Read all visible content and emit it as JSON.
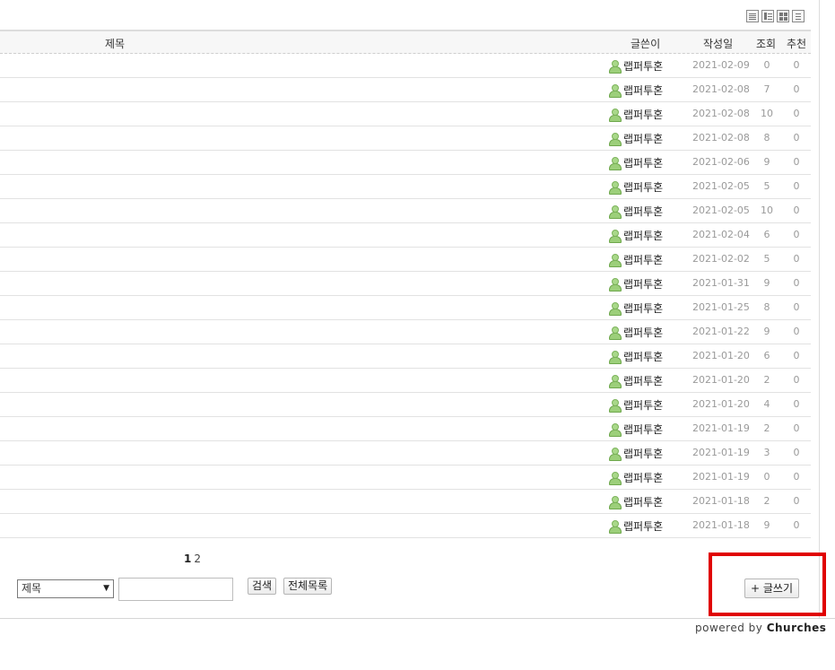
{
  "view_modes": [
    {
      "name": "list-view"
    },
    {
      "name": "webzine-view"
    },
    {
      "name": "gallery-view"
    },
    {
      "name": "text-view"
    }
  ],
  "table": {
    "headers": {
      "title": "제목",
      "author": "글쓴이",
      "date": "작성일",
      "views": "조회",
      "recommend": "추천"
    },
    "rows": [
      {
        "author": "랩퍼투혼",
        "date": "2021-02-09",
        "views": "0",
        "recommend": "0"
      },
      {
        "author": "랩퍼투혼",
        "date": "2021-02-08",
        "views": "7",
        "recommend": "0"
      },
      {
        "author": "랩퍼투혼",
        "date": "2021-02-08",
        "views": "10",
        "recommend": "0"
      },
      {
        "author": "랩퍼투혼",
        "date": "2021-02-08",
        "views": "8",
        "recommend": "0"
      },
      {
        "author": "랩퍼투혼",
        "date": "2021-02-06",
        "views": "9",
        "recommend": "0"
      },
      {
        "author": "랩퍼투혼",
        "date": "2021-02-05",
        "views": "5",
        "recommend": "0"
      },
      {
        "author": "랩퍼투혼",
        "date": "2021-02-05",
        "views": "10",
        "recommend": "0"
      },
      {
        "author": "랩퍼투혼",
        "date": "2021-02-04",
        "views": "6",
        "recommend": "0"
      },
      {
        "author": "랩퍼투혼",
        "date": "2021-02-02",
        "views": "5",
        "recommend": "0"
      },
      {
        "author": "랩퍼투혼",
        "date": "2021-01-31",
        "views": "9",
        "recommend": "0"
      },
      {
        "author": "랩퍼투혼",
        "date": "2021-01-25",
        "views": "8",
        "recommend": "0"
      },
      {
        "author": "랩퍼투혼",
        "date": "2021-01-22",
        "views": "9",
        "recommend": "0"
      },
      {
        "author": "랩퍼투혼",
        "date": "2021-01-20",
        "views": "6",
        "recommend": "0"
      },
      {
        "author": "랩퍼투혼",
        "date": "2021-01-20",
        "views": "2",
        "recommend": "0"
      },
      {
        "author": "랩퍼투혼",
        "date": "2021-01-20",
        "views": "4",
        "recommend": "0"
      },
      {
        "author": "랩퍼투혼",
        "date": "2021-01-19",
        "views": "2",
        "recommend": "0"
      },
      {
        "author": "랩퍼투혼",
        "date": "2021-01-19",
        "views": "3",
        "recommend": "0"
      },
      {
        "author": "랩퍼투혼",
        "date": "2021-01-19",
        "views": "0",
        "recommend": "0"
      },
      {
        "author": "랩퍼투혼",
        "date": "2021-01-18",
        "views": "2",
        "recommend": "0"
      },
      {
        "author": "랩퍼투혼",
        "date": "2021-01-18",
        "views": "9",
        "recommend": "0"
      }
    ]
  },
  "pagination": {
    "current": "1",
    "pages": [
      "2"
    ]
  },
  "search": {
    "selected_option": "제목",
    "input_value": "",
    "search_button": "검색",
    "all_list_button": "전체목록"
  },
  "write_button": "+ 글쓰기",
  "footer": {
    "powered_prefix": "powered by",
    "brand": "Churches"
  },
  "colors": {
    "highlight": "#e00000",
    "author_icon": "#9ccf7a",
    "muted_text": "#9a9a9a"
  }
}
